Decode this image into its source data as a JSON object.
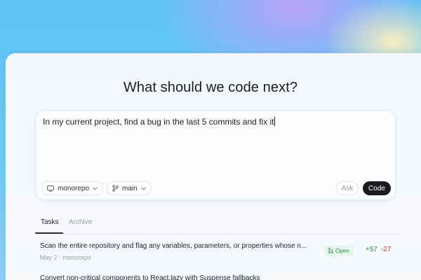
{
  "headline": "What should we code next?",
  "composer": {
    "prompt_text": "In my current project, find a bug in the last 5 commits and fix it",
    "repo_label": "monorepo",
    "branch_label": "main",
    "ask_label": "Ask",
    "code_label": "Code"
  },
  "tabs": [
    {
      "label": "Tasks",
      "active": true
    },
    {
      "label": "Archive",
      "active": false
    }
  ],
  "tasks": [
    {
      "title": "Scan the entire repository and flag any variables, parameters, or properties whose n...",
      "meta": "May 2 · monorepo",
      "status": "Open",
      "additions": "+57",
      "deletions": "-27"
    },
    {
      "title": "Convert non-critical components to React.lazy with Suspense fallbacks",
      "meta": "",
      "status": "",
      "additions": "",
      "deletions": ""
    }
  ],
  "icons": {
    "repo": "monitor-icon",
    "branch": "git-branch-icon",
    "chevron": "chevron-down-icon",
    "pr": "pull-request-icon"
  },
  "colors": {
    "accent_dark": "#1a1b1e",
    "open_green": "#2f8d45",
    "add_green": "#2c9a4a",
    "del_red": "#d24343"
  }
}
